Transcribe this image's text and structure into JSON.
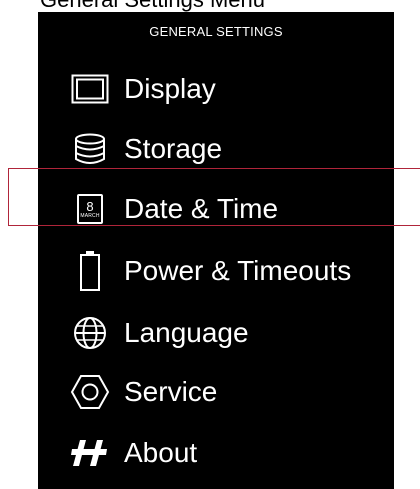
{
  "caption": "General Settings Menu",
  "menu": {
    "header": "GENERAL SETTINGS",
    "items": [
      {
        "label": "Display",
        "icon": "display-icon"
      },
      {
        "label": "Storage",
        "icon": "storage-icon"
      },
      {
        "label": "Date & Time",
        "icon": "calendar-icon",
        "selected": true
      },
      {
        "label": "Power & Timeouts",
        "icon": "battery-icon"
      },
      {
        "label": "Language",
        "icon": "globe-icon"
      },
      {
        "label": "Service",
        "icon": "service-icon"
      },
      {
        "label": "About",
        "icon": "brand-logo-icon"
      }
    ]
  },
  "calendar_icon": {
    "day": "8",
    "month": "MARCH"
  },
  "colors": {
    "background": "#000000",
    "text": "#ffffff",
    "selection_outline": "#b0253a"
  }
}
